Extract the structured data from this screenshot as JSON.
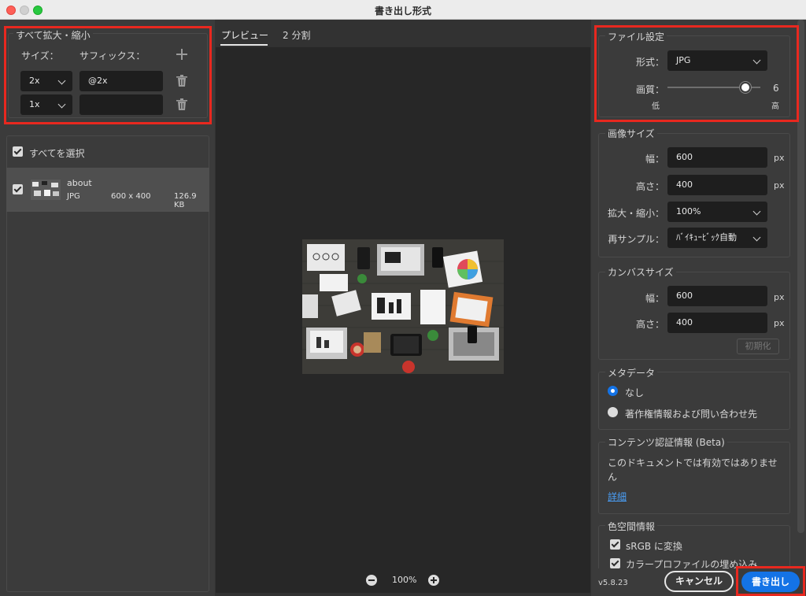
{
  "window": {
    "title": "書き出し形式"
  },
  "scale_group": {
    "legend": "すべて拡大・縮小",
    "size_label": "サイズ：",
    "suffix_label": "サフィックス：",
    "add_icon": "plus-icon",
    "rows": [
      {
        "size": "2x",
        "suffix": "@2x"
      },
      {
        "size": "1x",
        "suffix": ""
      }
    ]
  },
  "asset_list": {
    "select_all_label": "すべてを選択",
    "items": [
      {
        "name": "about",
        "format": "JPG",
        "dimensions": "600 x 400",
        "filesize": "126.9 KB",
        "checked": true
      }
    ]
  },
  "tabs": {
    "preview": "プレビュー",
    "split": "2 分割"
  },
  "zoom": {
    "level": "100%"
  },
  "file_settings": {
    "legend": "ファイル設定",
    "format_label": "形式：",
    "format_value": "JPG",
    "quality_label": "画質：",
    "quality_value": "6",
    "quality_low": "低",
    "quality_high": "高",
    "quality_fraction": 0.84
  },
  "image_size": {
    "legend": "画像サイズ",
    "width_label": "幅：",
    "width_value": "600",
    "height_label": "高さ：",
    "height_value": "400",
    "unit": "px",
    "scale_label": "拡大・縮小：",
    "scale_value": "100%",
    "resample_label": "再サンプル：",
    "resample_value": "ﾊﾞｲｷｭｰﾋﾞｯｸ自動"
  },
  "canvas_size": {
    "legend": "カンバスサイズ",
    "width_label": "幅：",
    "width_value": "600",
    "height_label": "高さ：",
    "height_value": "400",
    "unit": "px",
    "reset_label": "初期化"
  },
  "metadata": {
    "legend": "メタデータ",
    "option_none": "なし",
    "option_copyright": "著作権情報および問い合わせ先",
    "selected": "なし"
  },
  "content_credentials": {
    "legend": "コンテンツ認証情報 (Beta)",
    "message": "このドキュメントでは有効ではありません",
    "details_link": "詳細"
  },
  "color_space": {
    "legend": "色空間情報",
    "convert_srgb": "sRGB に変換",
    "embed_profile": "カラープロファイルの埋め込み"
  },
  "footer": {
    "version": "v5.8.23",
    "cancel_label": "キャンセル",
    "export_label": "書き出し"
  },
  "colors": {
    "accent": "#1473e6",
    "highlight_box": "#e8281f",
    "panel_bg": "#3b3b3b",
    "preview_bg": "#272727"
  }
}
